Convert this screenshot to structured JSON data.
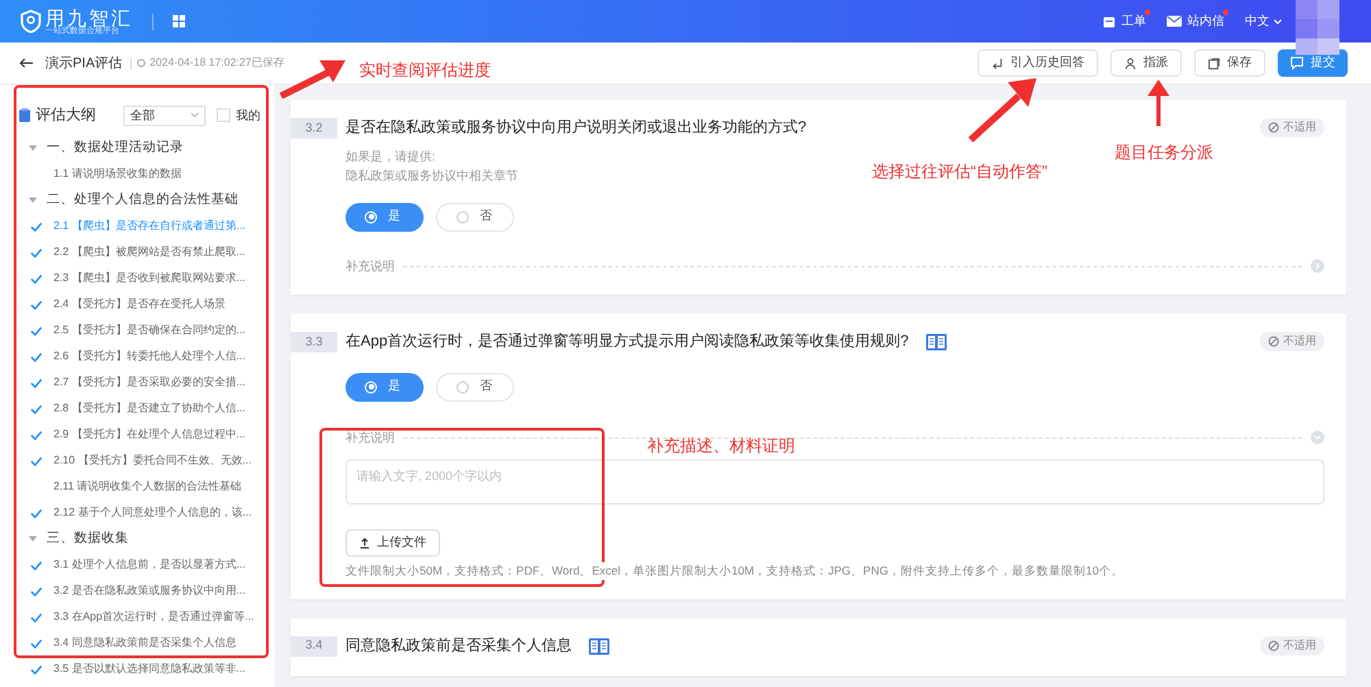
{
  "header": {
    "logo_name": "用九智汇",
    "logo_tagline": "一站式数据合规平台",
    "nav": [
      {
        "label": "工单",
        "kind": "ticket",
        "badge": true
      },
      {
        "label": "站内信",
        "kind": "mail",
        "badge": true
      }
    ],
    "language": "中文"
  },
  "subheader": {
    "title": "演示PIA评估",
    "saved": "2024-04-18 17:02:27已保存",
    "buttons": [
      {
        "label": "引入历史回答",
        "kind": "history",
        "primary": false
      },
      {
        "label": "指派",
        "kind": "assign",
        "primary": false
      },
      {
        "label": "保存",
        "kind": "save",
        "primary": false
      },
      {
        "label": "提交",
        "kind": "submit",
        "primary": true
      }
    ]
  },
  "sidebar": {
    "title": "评估大纲",
    "filter": "全部",
    "mine": {
      "label": "我的",
      "checked": false
    },
    "sections": [
      {
        "label": "一、数据处理活动记录",
        "expanded": true,
        "children": [
          {
            "label": "1.1 请说明场景收集的数据",
            "checked": false,
            "selected": false
          }
        ]
      },
      {
        "label": "二、处理个人信息的合法性基础",
        "expanded": true,
        "children": [
          {
            "label": "2.1 【爬虫】是否存在自行或者通过第...",
            "checked": true,
            "selected": true
          },
          {
            "label": "2.2 【爬虫】被爬网站是否有禁止爬取...",
            "checked": true,
            "selected": false
          },
          {
            "label": "2.3 【爬虫】是否收到被爬取网站要求...",
            "checked": true,
            "selected": false
          },
          {
            "label": "2.4 【受托方】是否存在受托人场景",
            "checked": true,
            "selected": false
          },
          {
            "label": "2.5 【受托方】是否确保在合同约定的...",
            "checked": true,
            "selected": false
          },
          {
            "label": "2.6 【受托方】转委托他人处理个人信...",
            "checked": true,
            "selected": false
          },
          {
            "label": "2.7 【受托方】是否采取必要的安全措...",
            "checked": true,
            "selected": false
          },
          {
            "label": "2.8 【受托方】是否建立了协助个人信...",
            "checked": true,
            "selected": false
          },
          {
            "label": "2.9 【受托方】在处理个人信息过程中...",
            "checked": true,
            "selected": false
          },
          {
            "label": "2.10 【受托方】委托合同不生效、无效...",
            "checked": true,
            "selected": false
          },
          {
            "label": "2.11 请说明收集个人数据的合法性基础",
            "checked": false,
            "selected": false
          },
          {
            "label": "2.12 基于个人同意处理个人信息的，该...",
            "checked": true,
            "selected": false
          }
        ]
      },
      {
        "label": "三、数据收集",
        "expanded": true,
        "children": [
          {
            "label": "3.1 处理个人信息前，是否以显著方式...",
            "checked": true,
            "selected": false
          },
          {
            "label": "3.2 是否在隐私政策或服务协议中向用...",
            "checked": true,
            "selected": false
          },
          {
            "label": "3.3 在App首次运行时，是否通过弹窗等...",
            "checked": true,
            "selected": false
          },
          {
            "label": "3.4 同意隐私政策前是否采集个人信息",
            "checked": true,
            "selected": false
          },
          {
            "label": "3.5 是否以默认选择同意隐私政策等非...",
            "checked": true,
            "selected": false
          }
        ]
      }
    ]
  },
  "questions": [
    {
      "number": "3.2",
      "title": "是否在隐私政策或服务协议中向用户说明关闭或退出业务功能的方式?",
      "book_icon": false,
      "hints": [
        "如果是，请提供:",
        "隐私政策或服务协议中相关章节"
      ],
      "na_label": "不适用",
      "options": [
        {
          "label": "是",
          "selected": true
        },
        {
          "label": "否",
          "selected": false
        }
      ],
      "supplement": {
        "label": "补充说明",
        "expanded": false
      }
    },
    {
      "number": "3.3",
      "title": "在App首次运行时，是否通过弹窗等明显方式提示用户阅读隐私政策等收集使用规则?",
      "book_icon": true,
      "na_label": "不适用",
      "options": [
        {
          "label": "是",
          "selected": true
        },
        {
          "label": "否",
          "selected": false
        }
      ],
      "supplement": {
        "label": "补充说明",
        "expanded": true,
        "placeholder": "请输入文字, 2000个字以内",
        "upload": "上传文件",
        "note": "文件限制大小50M，支持格式：PDF、Word、Excel，单张图片限制大小10M，支持格式：JPG、PNG，附件支持上传多个，最多数量限制10个。"
      }
    },
    {
      "number": "3.4",
      "title": "同意隐私政策前是否采集个人信息",
      "book_icon": true,
      "na_label": "不适用"
    }
  ],
  "annotations": [
    {
      "kind": "arrow-right",
      "text": "实时查阅评估进度"
    },
    {
      "kind": "arrow-up",
      "text": "选择过往评估“自动作答”"
    },
    {
      "kind": "arrow-up-straight",
      "text": "题目任务分派"
    },
    {
      "kind": "box",
      "text": "补充描述、材料证明"
    }
  ]
}
